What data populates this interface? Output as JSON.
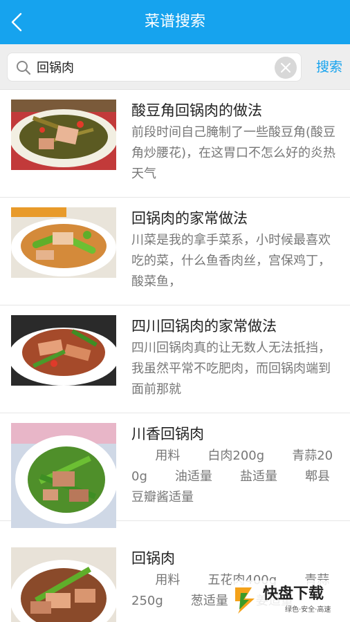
{
  "header": {
    "title": "菜谱搜索"
  },
  "search": {
    "value": "回锅肉",
    "button_label": "搜索"
  },
  "results": [
    {
      "title": "酸豆角回锅肉的做法",
      "desc": "前段时间自己腌制了一些酸豆角(酸豆角炒腰花)，在这胃口不怎么好的炎热天气"
    },
    {
      "title": "回锅肉的家常做法",
      "desc": "川菜是我的拿手菜系，小时候最喜欢吃的菜，什么鱼香肉丝，宫保鸡丁，酸菜鱼，"
    },
    {
      "title": "四川回锅肉的家常做法",
      "desc": "四川回锅肉真的让无数人无法抵挡，我虽然平常不吃肥肉，而回锅肉端到面前那就"
    },
    {
      "title": "川香回锅肉",
      "desc": "      用料       白肉200g       青蒜200g       油适量       盐适量       郫县豆瓣酱适量"
    },
    {
      "title": "回锅肉",
      "desc": "      用料       五花肉400g       青蒜250g       葱适量       姜适量"
    }
  ],
  "watermark": {
    "brand": "快盘下载",
    "tagline": "绿色·安全·高速"
  },
  "colors": {
    "accent": "#16a3ee",
    "header_text": "#ffffff",
    "desc_text": "#777777"
  }
}
